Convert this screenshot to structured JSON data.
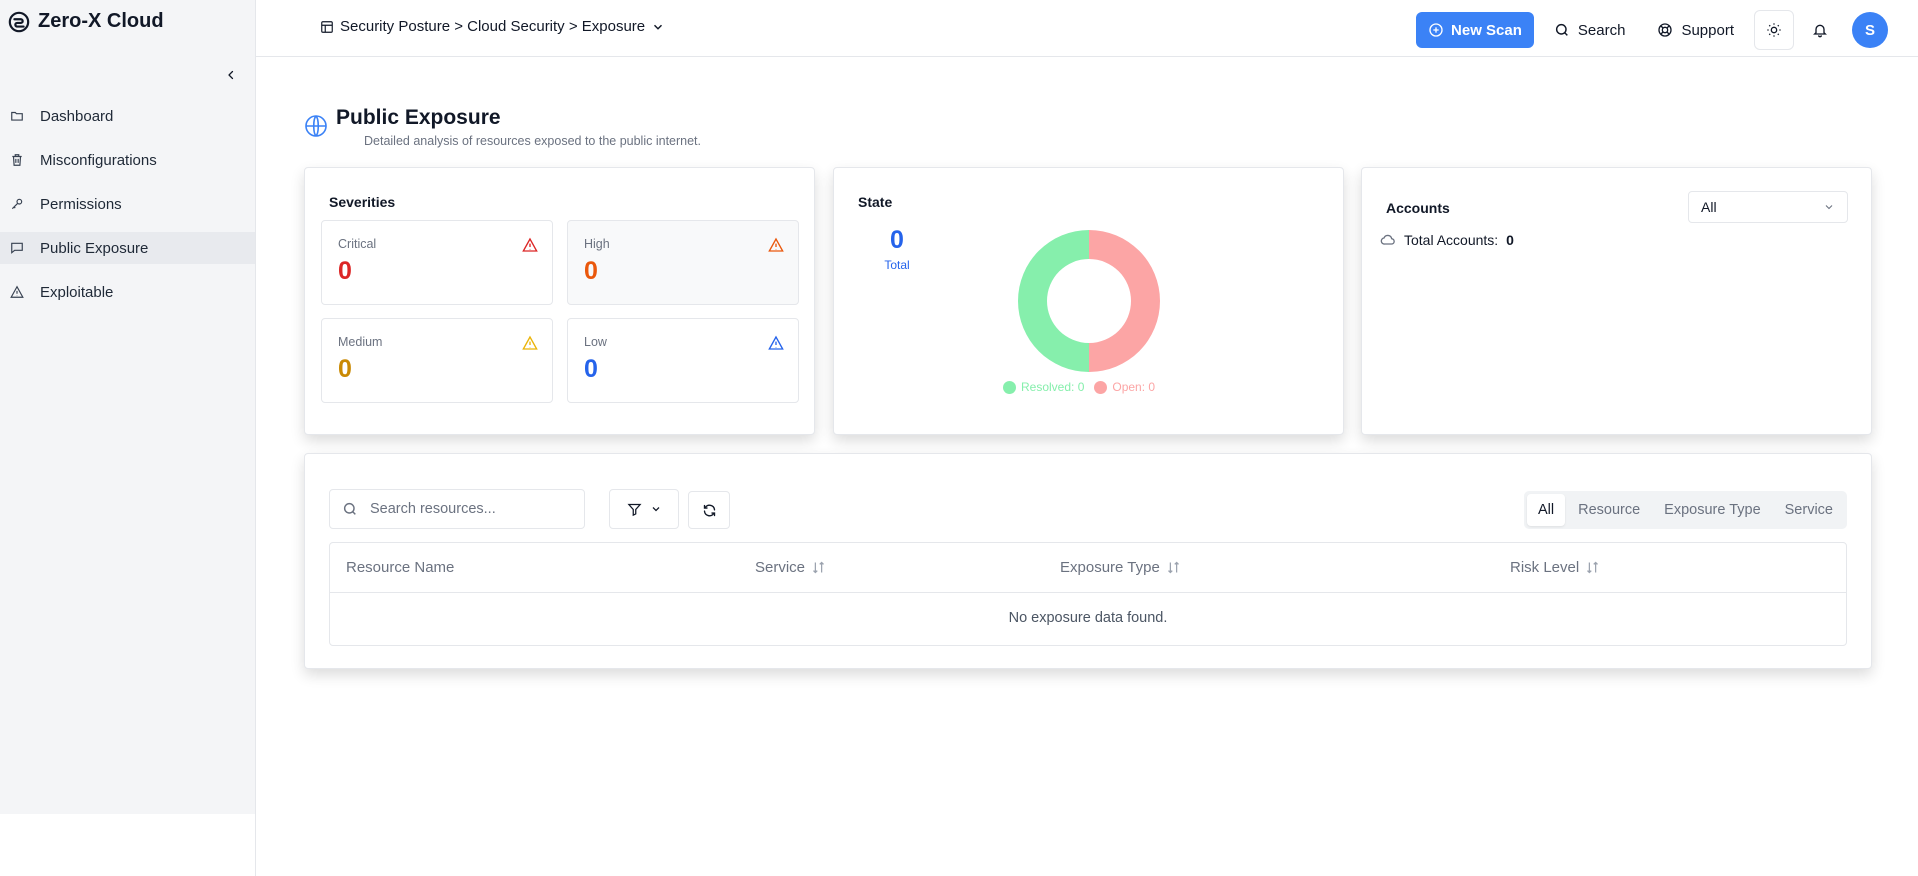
{
  "app": {
    "name": "Zero-X Cloud"
  },
  "sidebar": {
    "items": [
      {
        "label": "Dashboard",
        "icon": "folder-icon"
      },
      {
        "label": "Misconfigurations",
        "icon": "trash-icon"
      },
      {
        "label": "Permissions",
        "icon": "key-icon"
      },
      {
        "label": "Public Exposure",
        "icon": "message-square-icon",
        "active": true
      },
      {
        "label": "Exploitable",
        "icon": "alert-triangle-icon"
      }
    ]
  },
  "header": {
    "breadcrumb": "Security Posture > Cloud Security > Exposure",
    "new_scan_label": "New Scan",
    "search_label": "Search",
    "support_label": "Support",
    "avatar_initial": "S"
  },
  "page": {
    "title": "Public Exposure",
    "subtitle": "Detailed analysis of resources exposed to the public internet."
  },
  "severities": {
    "title": "Severities",
    "critical": {
      "label": "Critical",
      "value": "0",
      "color": "#dc2626"
    },
    "high": {
      "label": "High",
      "value": "0",
      "color": "#ea580c"
    },
    "medium": {
      "label": "Medium",
      "value": "0",
      "color": "#ca8a04"
    },
    "low": {
      "label": "Low",
      "value": "0",
      "color": "#2563eb"
    }
  },
  "state": {
    "title": "State",
    "total_value": "0",
    "total_label": "Total",
    "resolved_legend": "Resolved: 0",
    "open_legend": "Open: 0",
    "resolved_color": "#86efac",
    "open_color": "#fca5a5"
  },
  "accounts": {
    "title": "Accounts",
    "filter_value": "All",
    "total_label": "Total Accounts:",
    "total_value": "0"
  },
  "resources": {
    "search_placeholder": "Search resources...",
    "tabs": [
      "All",
      "Resource",
      "Exposure Type",
      "Service"
    ],
    "columns": [
      "Resource Name",
      "Service",
      "Exposure Type",
      "Risk Level"
    ],
    "empty_message": "No exposure data found."
  }
}
